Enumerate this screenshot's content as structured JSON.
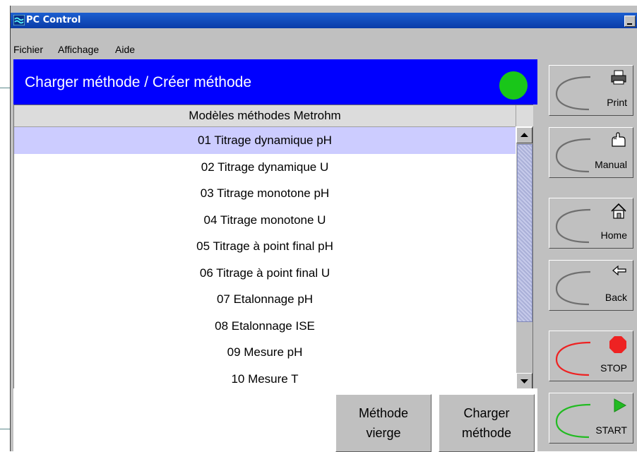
{
  "window": {
    "title": "PC Control"
  },
  "menu": [
    "Fichier",
    "Affichage",
    "Aide"
  ],
  "header": {
    "title": "Charger méthode / Créer méthode",
    "status_color": "#19c619"
  },
  "list": {
    "column_header": "Modèles méthodes Metrohm",
    "selected_index": 0,
    "items": [
      "01 Titrage dynamique pH",
      "02 Titrage dynamique U",
      "03 Titrage monotone pH",
      "04 Titrage monotone U",
      "05 Titrage à point final pH",
      "06 Titrage à point final U",
      "07 Etalonnage pH",
      "08 Etalonnage ISE",
      "09 Mesure pH",
      "10 Mesure T"
    ]
  },
  "actions": {
    "blank_method": {
      "line1": "Méthode",
      "line2": "vierge"
    },
    "load_method": {
      "line1": "Charger",
      "line2": "méthode"
    }
  },
  "side": {
    "print": "Print",
    "manual": "Manual",
    "home": "Home",
    "back": "Back",
    "stop": "STOP",
    "start": "START"
  },
  "colors": {
    "header_bg": "#0000ff",
    "selection": "#ccccff",
    "stop": "#ee2222",
    "start": "#22bb22"
  }
}
